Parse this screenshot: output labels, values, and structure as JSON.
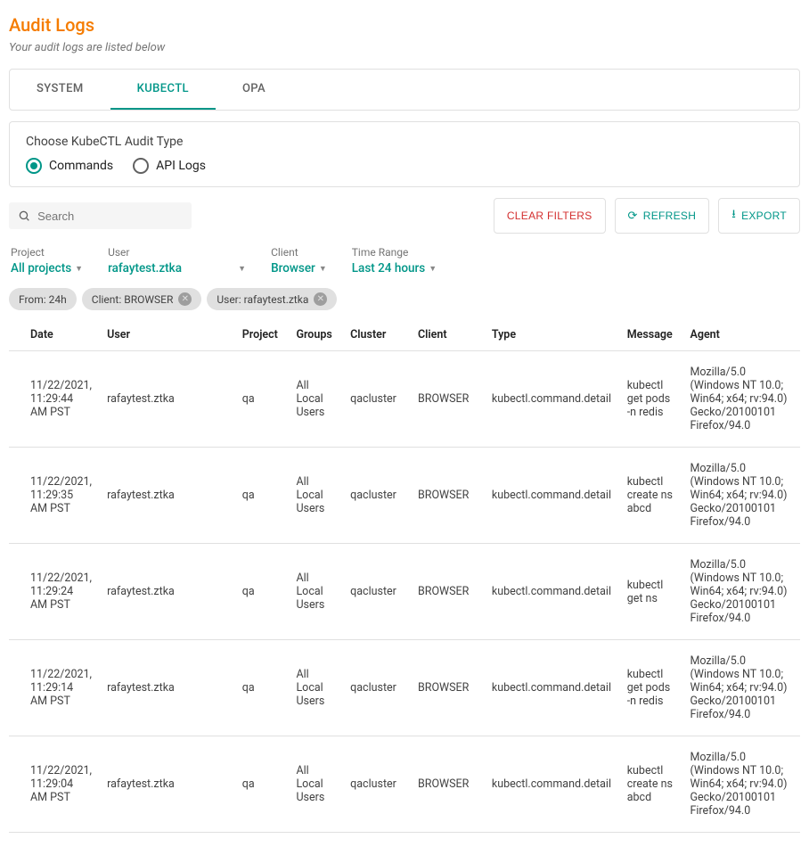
{
  "header": {
    "title": "Audit Logs",
    "subtitle": "Your audit logs are listed below"
  },
  "tabs": [
    {
      "label": "SYSTEM",
      "active": false
    },
    {
      "label": "KUBECTL",
      "active": true
    },
    {
      "label": "OPA",
      "active": false
    }
  ],
  "audit_type": {
    "title": "Choose KubeCTL Audit Type",
    "options": [
      {
        "label": "Commands",
        "selected": true
      },
      {
        "label": "API Logs",
        "selected": false
      }
    ]
  },
  "search": {
    "placeholder": "Search"
  },
  "actions": {
    "clear": "CLEAR FILTERS",
    "refresh": "REFRESH",
    "export": "EXPORT"
  },
  "filters": {
    "project": {
      "label": "Project",
      "value": "All projects"
    },
    "user": {
      "label": "User",
      "value": "rafaytest.ztka"
    },
    "client": {
      "label": "Client",
      "value": "Browser"
    },
    "timerange": {
      "label": "Time Range",
      "value": "Last 24 hours"
    }
  },
  "chips": [
    {
      "label": "From: 24h",
      "dismissible": false
    },
    {
      "label": "Client: BROWSER",
      "dismissible": true
    },
    {
      "label": "User: rafaytest.ztka",
      "dismissible": true
    }
  ],
  "table": {
    "columns": [
      "Date",
      "User",
      "Project",
      "Groups",
      "Cluster",
      "Client",
      "Type",
      "Message",
      "Agent"
    ],
    "rows": [
      {
        "date": "11/22/2021, 11:29:44 AM PST",
        "user": "rafaytest.ztka",
        "project": "qa",
        "groups": "All Local Users",
        "cluster": "qacluster",
        "client": "BROWSER",
        "type": "kubectl.command.detail",
        "message": "kubectl get pods -n redis",
        "agent": "Mozilla/5.0 (Windows NT 10.0; Win64; x64; rv:94.0) Gecko/20100101 Firefox/94.0"
      },
      {
        "date": "11/22/2021, 11:29:35 AM PST",
        "user": "rafaytest.ztka",
        "project": "qa",
        "groups": "All Local Users",
        "cluster": "qacluster",
        "client": "BROWSER",
        "type": "kubectl.command.detail",
        "message": "kubectl create ns abcd",
        "agent": "Mozilla/5.0 (Windows NT 10.0; Win64; x64; rv:94.0) Gecko/20100101 Firefox/94.0"
      },
      {
        "date": "11/22/2021, 11:29:24 AM PST",
        "user": "rafaytest.ztka",
        "project": "qa",
        "groups": "All Local Users",
        "cluster": "qacluster",
        "client": "BROWSER",
        "type": "kubectl.command.detail",
        "message": "kubectl get ns",
        "agent": "Mozilla/5.0 (Windows NT 10.0; Win64; x64; rv:94.0) Gecko/20100101 Firefox/94.0"
      },
      {
        "date": "11/22/2021, 11:29:14 AM PST",
        "user": "rafaytest.ztka",
        "project": "qa",
        "groups": "All Local Users",
        "cluster": "qacluster",
        "client": "BROWSER",
        "type": "kubectl.command.detail",
        "message": "kubectl get pods -n redis",
        "agent": "Mozilla/5.0 (Windows NT 10.0; Win64; x64; rv:94.0) Gecko/20100101 Firefox/94.0"
      },
      {
        "date": "11/22/2021, 11:29:04 AM PST",
        "user": "rafaytest.ztka",
        "project": "qa",
        "groups": "All Local Users",
        "cluster": "qacluster",
        "client": "BROWSER",
        "type": "kubectl.command.detail",
        "message": "kubectl create ns abcd",
        "agent": "Mozilla/5.0 (Windows NT 10.0; Win64; x64; rv:94.0) Gecko/20100101 Firefox/94.0"
      }
    ]
  }
}
